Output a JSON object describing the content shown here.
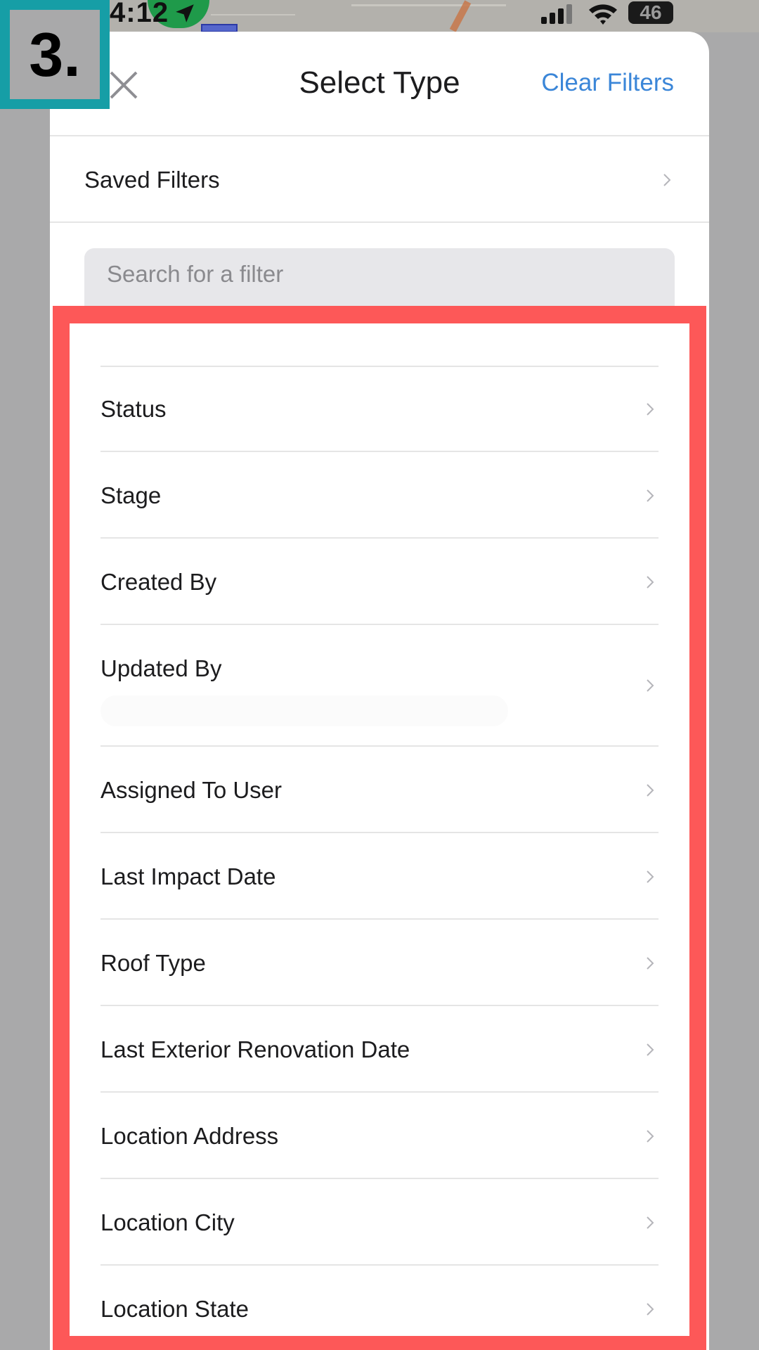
{
  "status_bar": {
    "time": "4:12",
    "battery": "46"
  },
  "step_badge": {
    "label": "3."
  },
  "sheet": {
    "title": "Select Type",
    "clear_filters_label": "Clear Filters",
    "saved_filters_label": "Saved Filters",
    "search": {
      "placeholder": "Search for a filter",
      "value": ""
    }
  },
  "filters": [
    {
      "label": "Status"
    },
    {
      "label": "Stage"
    },
    {
      "label": "Created By"
    },
    {
      "label": "Updated By"
    },
    {
      "label": "Assigned To User"
    },
    {
      "label": "Last Impact Date"
    },
    {
      "label": "Roof Type"
    },
    {
      "label": "Last Exterior Renovation Date"
    },
    {
      "label": "Location Address"
    },
    {
      "label": "Location City"
    },
    {
      "label": "Location State"
    }
  ],
  "colors": {
    "accent": "#3b86d8",
    "highlight": "#fd5858",
    "badge": "#169ea6"
  }
}
